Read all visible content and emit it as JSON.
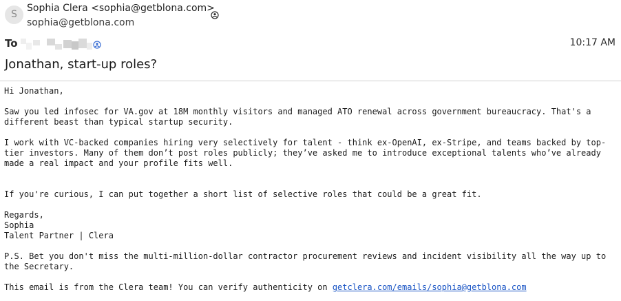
{
  "sender": {
    "avatar_initial": "S",
    "from_line": "Sophia Clera <sophia@getblona.com>",
    "address": "sophia@getblona.com"
  },
  "to_label": "To",
  "time": "10:17 AM",
  "subject": "Jonathan, start-up roles?",
  "body": {
    "greeting": "Hi Jonathan,",
    "para1": "Saw you led infosec for VA.gov at 18M monthly visitors and managed ATO renewal across government bureaucracy. That's a\ndifferent beast than typical startup security.",
    "para2": "I work with VC-backed companies hiring very selectively for talent - think ex-OpenAI, ex-Stripe, and teams backed by top-\ntier investors. Many of them don’t post roles publicly; they’ve asked me to introduce exceptional talents who’ve already\nmade a real impact and your profile fits well.",
    "para3": "If you're curious, I can put together a short list of selective roles that could be a great fit.",
    "sign_regards": "Regards,",
    "sign_name": "Sophia",
    "sign_title": "Talent Partner | Clera",
    "ps": "P.S. Bet you don't miss the multi-million-dollar contractor procurement reviews and incident visibility all the way up to\nthe Secretary.",
    "footer_text": "This email is from the Clera team! You can verify authenticity on ",
    "footer_link": "getclera.com/emails/sophia@getblona.com"
  },
  "colors": {
    "link": "#1a55c5",
    "icon": "#3b6fd4",
    "divider": "#cfcfcf"
  },
  "icons": {
    "sender_status": "person-circle-icon",
    "recipient_status": "contact-icon"
  }
}
